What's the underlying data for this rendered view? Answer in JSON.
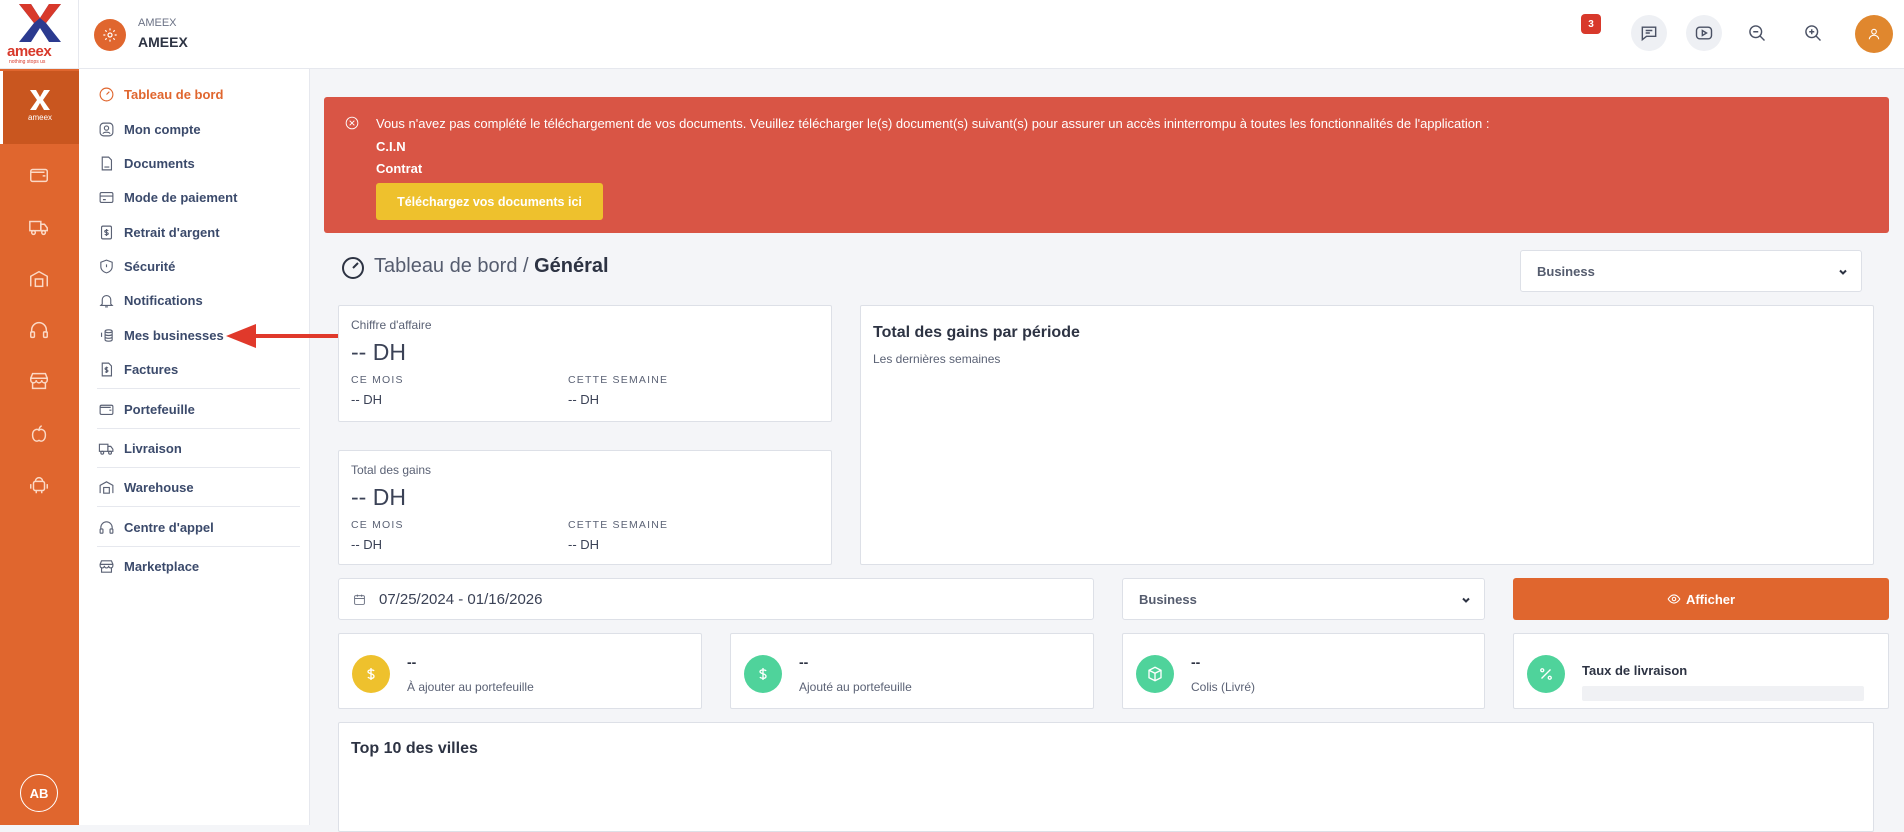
{
  "brand": {
    "word": "ameex",
    "tagline": "nothing stops us",
    "accent": "#e0662e"
  },
  "header": {
    "company_small": "AMEEX",
    "company_big": "AMEEX",
    "notification_count": "3",
    "icons": [
      "message-icon",
      "video-icon",
      "zoom-out-icon",
      "zoom-in-icon",
      "user-icon"
    ]
  },
  "rail": {
    "items": [
      "dashboard-logo-icon",
      "wallet-icon",
      "truck-icon",
      "warehouse-icon",
      "headset-icon",
      "store-icon",
      "apple-icon",
      "android-icon"
    ],
    "avatar": "AB"
  },
  "submenu": {
    "items": [
      {
        "label": "Tableau de bord",
        "icon": "gauge-icon"
      },
      {
        "label": "Mon compte",
        "icon": "user-circle-icon"
      },
      {
        "label": "Documents",
        "icon": "document-icon"
      },
      {
        "label": "Mode de paiement",
        "icon": "card-icon"
      },
      {
        "label": "Retrait d'argent",
        "icon": "money-icon"
      },
      {
        "label": "Sécurité",
        "icon": "shield-icon"
      },
      {
        "label": "Notifications",
        "icon": "bell-icon"
      },
      {
        "label": "Mes businesses",
        "icon": "coins-icon"
      },
      {
        "label": "Factures",
        "icon": "invoice-icon"
      },
      {
        "label": "Portefeuille",
        "icon": "wallet-icon"
      },
      {
        "label": "Livraison",
        "icon": "truck-icon"
      },
      {
        "label": "Warehouse",
        "icon": "warehouse-icon"
      },
      {
        "label": "Centre d'appel",
        "icon": "headset-icon"
      },
      {
        "label": "Marketplace",
        "icon": "store-icon"
      }
    ]
  },
  "alert": {
    "message": "Vous n'avez pas complété le téléchargement de vos documents. Veuillez télécharger le(s) document(s) suivant(s) pour assurer un accès ininterrompu à toutes les fonctionnalités de l'application :",
    "documents": [
      "C.I.N",
      "Contrat"
    ],
    "button": "Téléchargez vos documents ici"
  },
  "breadcrumb": {
    "parent": "Tableau de bord / ",
    "current": "Général"
  },
  "business_select_top": "Business",
  "revenue_card": {
    "title": "Chiffre d'affaire",
    "value": "-- DH",
    "month_label": "CE MOIS",
    "month_value": "-- DH",
    "week_label": "CETTE SEMAINE",
    "week_value": "-- DH"
  },
  "earnings_card": {
    "title": "Total des gains",
    "value": "-- DH",
    "month_label": "CE MOIS",
    "month_value": "-- DH",
    "week_label": "CETTE SEMAINE",
    "week_value": "-- DH"
  },
  "earnings_chart": {
    "title": "Total des gains par période",
    "subtitle": "Les dernières semaines"
  },
  "filters": {
    "date_range": "07/25/2024 - 01/16/2026",
    "business": "Business",
    "show_button": "Afficher"
  },
  "stats": [
    {
      "value": "--",
      "label": "À ajouter au portefeuille",
      "color": "#eec12d"
    },
    {
      "value": "--",
      "label": "Ajouté au portefeuille",
      "color": "#4fd39b"
    },
    {
      "value": "--",
      "label": "Colis (Livré)",
      "color": "#4fd39b"
    },
    {
      "label": "Taux de livraison",
      "color": "#4fd39b"
    }
  ],
  "top_cities": {
    "title": "Top 10 des villes"
  }
}
